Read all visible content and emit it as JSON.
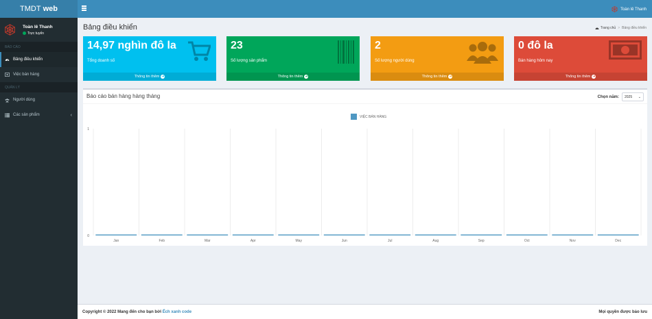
{
  "app": {
    "logo_left": "TMDT",
    "logo_right": "web"
  },
  "user": {
    "name": "Toàn lê Thanh",
    "status": "Trực tuyến"
  },
  "sidebar": {
    "section_report": "BÁO CÁO",
    "section_manage": "QUẢN LÝ",
    "items": [
      {
        "label": "Bảng điều khiển",
        "icon": "dashboard-icon"
      },
      {
        "label": "Việc bán hàng",
        "icon": "money-icon"
      },
      {
        "label": "Người dùng",
        "icon": "users-icon"
      },
      {
        "label": "Các sản phẩm",
        "icon": "list-icon"
      }
    ]
  },
  "navbar": {
    "user_name": "Toàn lê Thanh"
  },
  "page": {
    "title": "Bảng điều khiển"
  },
  "breadcrumb": {
    "home": "Trang chủ",
    "current": "Bảng điều khiển"
  },
  "boxes": [
    {
      "value": "14,97 nghìn đô la",
      "label": "Tổng doanh số",
      "footer": "Thông tin thêm",
      "color": "#00c0ef",
      "icon": "shopping-cart-icon"
    },
    {
      "value": "23",
      "label": "Số lượng sản phẩm",
      "footer": "Thông tin thêm",
      "color": "#00a65a",
      "icon": "barcode-icon"
    },
    {
      "value": "2",
      "label": "Số lượng người dùng",
      "footer": "Thông tin thêm",
      "color": "#f39c12",
      "icon": "users-icon"
    },
    {
      "value": "0 đô la",
      "label": "Bán hàng hôm nay",
      "footer": "Thông tin thêm",
      "color": "#dd4b39",
      "icon": "money-bill-icon"
    }
  ],
  "panel": {
    "title": "Báo cáo bán hàng hàng tháng",
    "select_label": "Chọn năm:",
    "select_value": "2025"
  },
  "chart_data": {
    "type": "bar",
    "categories": [
      "Jan",
      "Feb",
      "Mar",
      "Apr",
      "May",
      "Jun",
      "Jul",
      "Aug",
      "Sep",
      "Oct",
      "Nov",
      "Dec"
    ],
    "series": [
      {
        "name": "VIỆC BÁN HÀNG",
        "values": [
          0,
          0,
          0,
          0,
          0,
          0,
          0,
          0,
          0,
          0,
          0,
          0
        ]
      }
    ],
    "ylim": [
      0,
      1
    ],
    "yticks": [
      "0",
      "1"
    ],
    "grid": true,
    "legend": "top-center",
    "color": "#3c8dbc"
  },
  "footer": {
    "copyright_prefix": "Copyright © 2022 Mang đến cho bạn bởi",
    "author": "Ếch xanh code",
    "rights": "Mọi quyền được bảo lưu"
  }
}
